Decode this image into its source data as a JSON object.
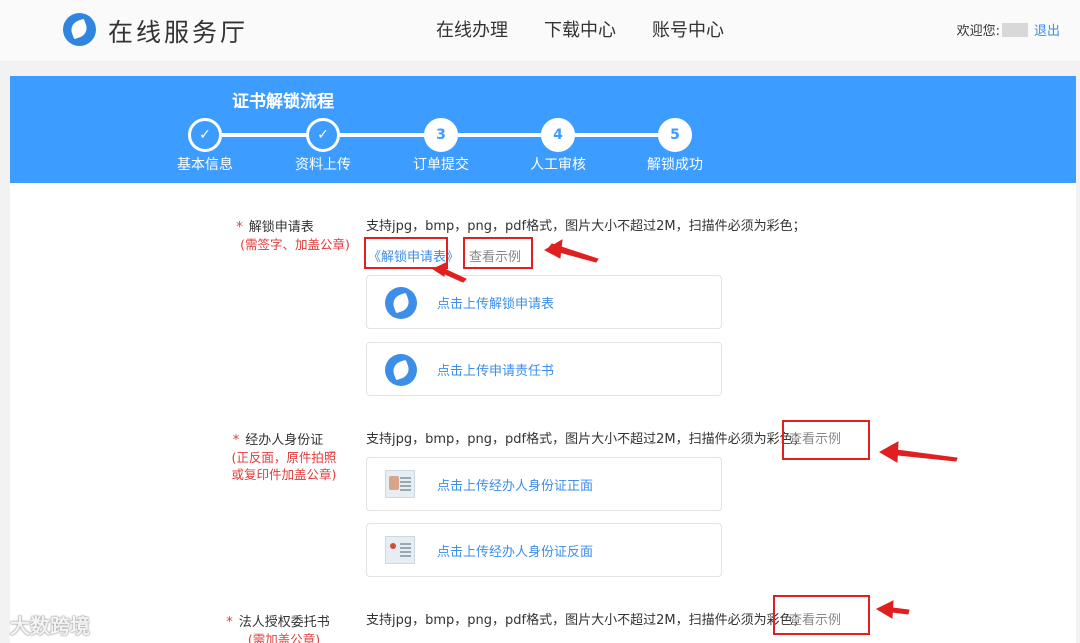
{
  "header": {
    "title": "在线服务厅",
    "nav": [
      "在线办理",
      "下载中心",
      "账号中心"
    ],
    "welcome": "欢迎您:",
    "logout": "退出"
  },
  "banner": {
    "title": "证书解锁流程",
    "steps": [
      {
        "label": "基本信息",
        "mark": "✓",
        "state": "done"
      },
      {
        "label": "资料上传",
        "mark": "✓",
        "state": "done"
      },
      {
        "label": "订单提交",
        "mark": "3",
        "state": "todo"
      },
      {
        "label": "人工审核",
        "mark": "4",
        "state": "todo"
      },
      {
        "label": "解锁成功",
        "mark": "5",
        "state": "todo"
      }
    ]
  },
  "form": {
    "hint": "支持jpg，bmp，png，pdf格式，图片大小不超过2M，扫描件必须为彩色；",
    "example_label": "查看示例",
    "fields": [
      {
        "label": "解锁申请表",
        "note": "(需签字、加盖公章)",
        "template_link": "《解锁申请表》",
        "uploads": [
          "点击上传解锁申请表",
          "点击上传申请责任书"
        ]
      },
      {
        "label": "经办人身份证",
        "note": "(正反面，原件拍照或复印件加盖公章)",
        "uploads": [
          "点击上传经办人身份证正面",
          "点击上传经办人身份证反面"
        ]
      },
      {
        "label": "法人授权委托书",
        "note": "(需加盖公章)"
      }
    ]
  },
  "watermark": "大数跨境",
  "colors": {
    "accent": "#3d9cff",
    "link": "#3c8ee8",
    "required": "#e03a3a",
    "annotation": "#e02020"
  }
}
